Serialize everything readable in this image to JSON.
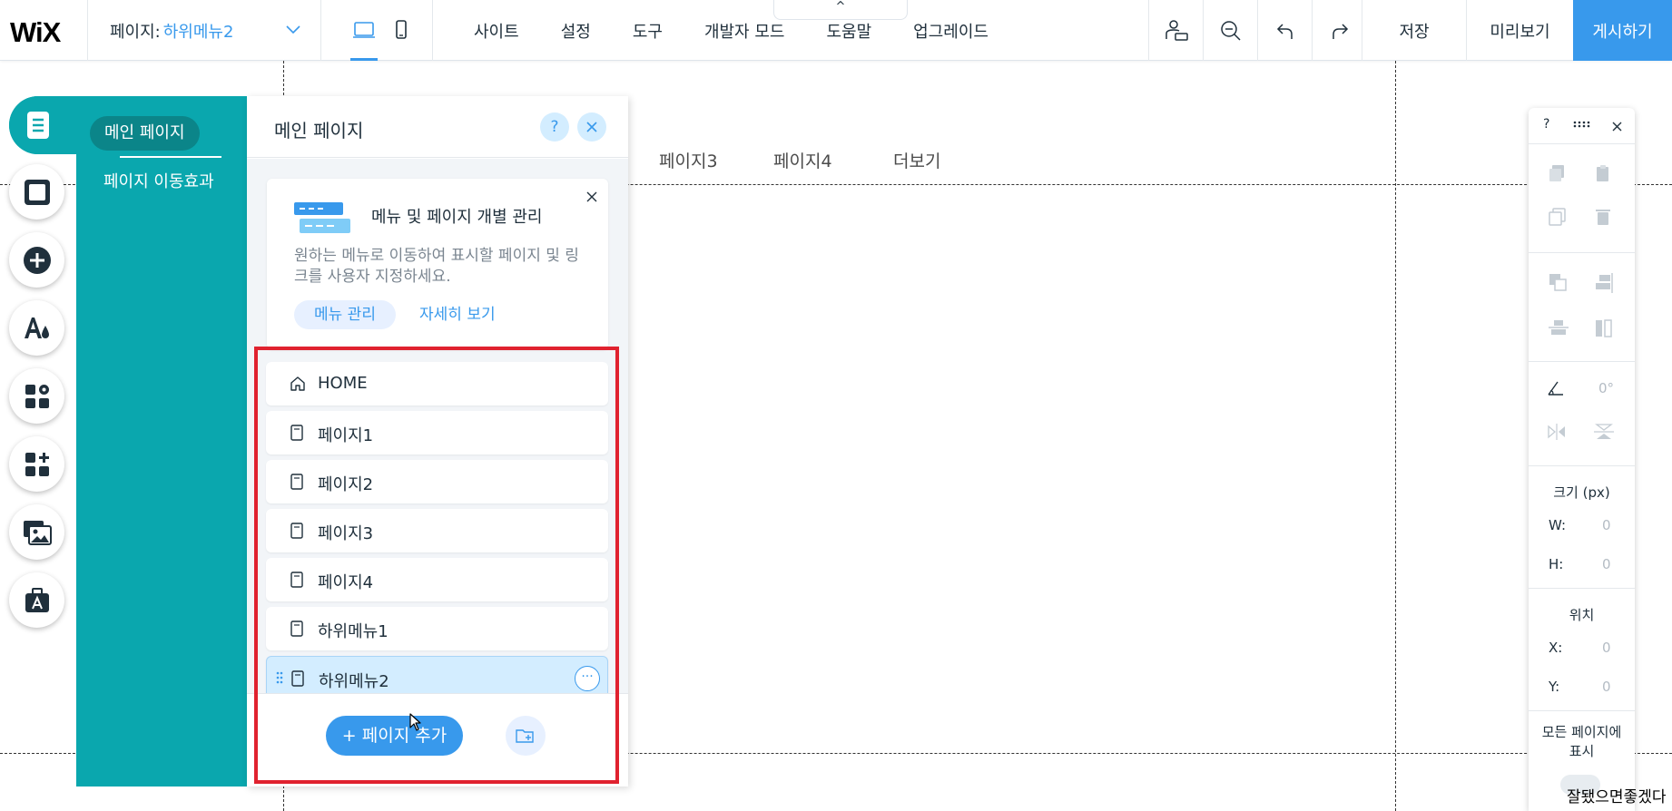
{
  "topbar": {
    "logo": "WiX",
    "page_selector_label": "페이지:",
    "page_selector_value": "하위메뉴2",
    "menu": [
      "사이트",
      "설정",
      "도구",
      "개발자 모드",
      "도움말",
      "업그레이드"
    ],
    "collapse_icon": "^",
    "save": "저장",
    "preview": "미리보기",
    "publish": "게시하기"
  },
  "site_nav": [
    "페이지3",
    "페이지4",
    "더보기"
  ],
  "pages_panel": {
    "tab_main": "메인 페이지",
    "tab_transitions": "페이지 이동효과",
    "title": "메인 페이지",
    "help": "?",
    "info_card": {
      "title": "메뉴 및 페이지 개별 관리",
      "description": "원하는 메뉴로 이동하여 표시할 페이지 및 링크를 사용자 지정하세요.",
      "manage_button": "메뉴 관리",
      "learn_more": "자세히 보기"
    },
    "pages": [
      {
        "label": "HOME",
        "icon": "home-icon"
      },
      {
        "label": "페이지1",
        "icon": "page-icon"
      },
      {
        "label": "페이지2",
        "icon": "page-icon"
      },
      {
        "label": "페이지3",
        "icon": "page-icon"
      },
      {
        "label": "페이지4",
        "icon": "page-icon"
      },
      {
        "label": "하위메뉴1",
        "icon": "page-icon"
      },
      {
        "label": "하위메뉴2",
        "icon": "page-icon",
        "selected": true
      }
    ],
    "more_button": "···",
    "add_page": "+ 페이지 추가"
  },
  "inspector": {
    "help": "?",
    "rotation": "0°",
    "size_title": "크기 (px)",
    "w_label": "W:",
    "w_value": "0",
    "h_label": "H:",
    "h_value": "0",
    "position_title": "위치",
    "x_label": "X:",
    "x_value": "0",
    "y_label": "Y:",
    "y_value": "0",
    "show_all_pages": "모든 페이지에 표시"
  },
  "overlay_text": "잘됐으면좋겠다",
  "colors": {
    "accent": "#3899ec",
    "teal": "#0aa7ae",
    "highlight": "#e0222f"
  }
}
